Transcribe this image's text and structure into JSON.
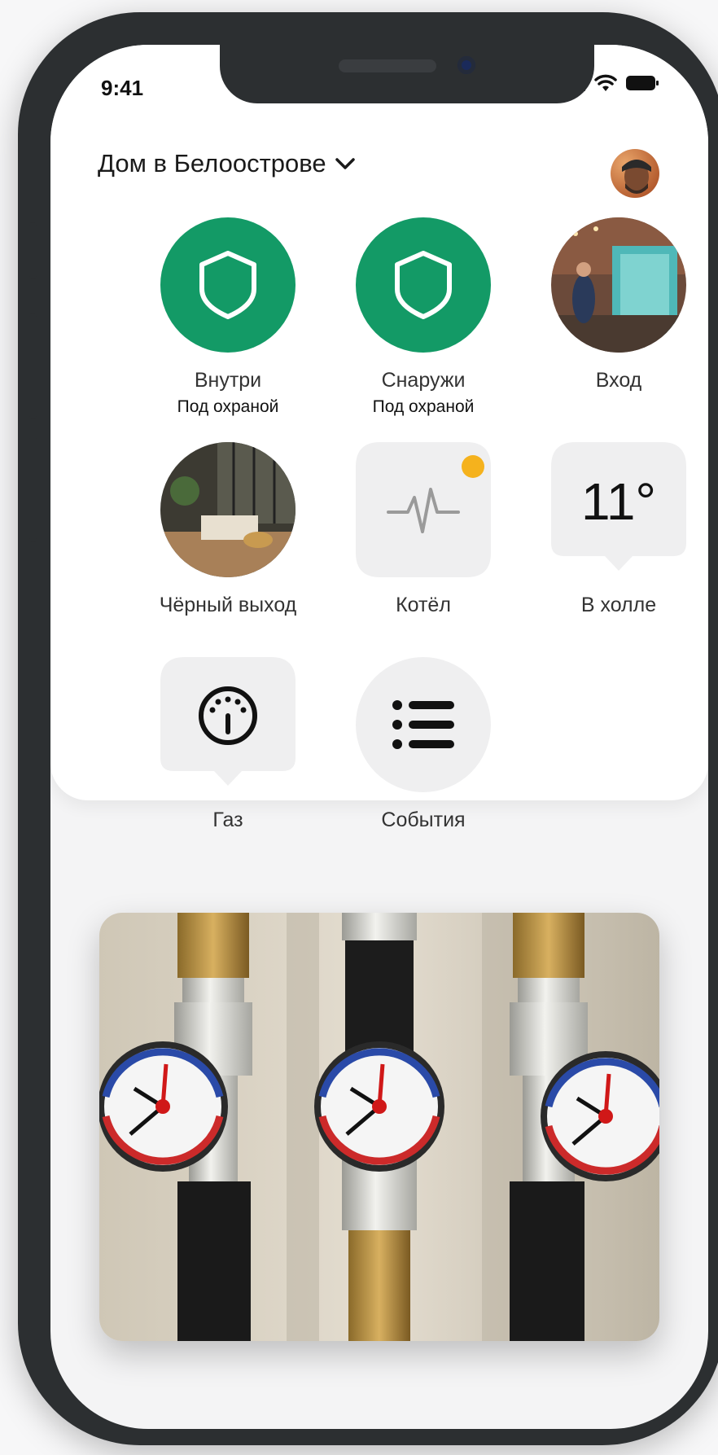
{
  "status": {
    "time": "9:41"
  },
  "header": {
    "title": "Дом в Белоострове"
  },
  "tiles": [
    {
      "label": "Внутри",
      "sub": "Под охраной"
    },
    {
      "label": "Снаружи",
      "sub": "Под охраной"
    },
    {
      "label": "Вход"
    },
    {
      "label": "Чёрный выход"
    },
    {
      "label": "Котёл"
    },
    {
      "label": "В холле",
      "value": "11°"
    },
    {
      "label": "Газ"
    },
    {
      "label": "События"
    }
  ],
  "colors": {
    "accent": "#139a66",
    "indicator": "#f5b21d",
    "frame": "#2c2f31"
  },
  "icons": [
    "shield-icon",
    "pulse-icon",
    "gauge-icon",
    "list-icon",
    "chevron-down-icon",
    "signal-icon",
    "wifi-icon",
    "battery-icon"
  ]
}
